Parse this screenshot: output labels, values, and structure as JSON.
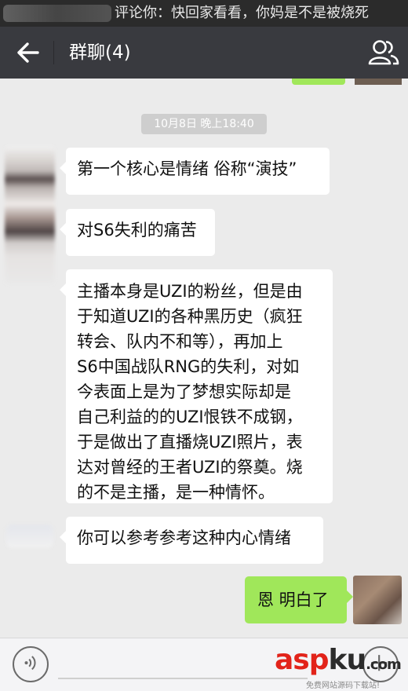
{
  "notification": {
    "text": "评论你：快回家看看，你妈是不是被烧死"
  },
  "header": {
    "title": "群聊(4)"
  },
  "chat": {
    "timestamp": "10月8日 晚上18:40",
    "messages": [
      {
        "side": "left",
        "text": "第一个核心是情绪   俗称“演技”"
      },
      {
        "side": "left",
        "text": "对S6失利的痛苦"
      },
      {
        "side": "left",
        "lines": [
          "主播本身是UZI的粉丝，但是由",
          "于知道UZI的各种黑历史（疯狂",
          "转会、队内不和等），再加上",
          "S6中国战队RNG的失利，对如",
          "今表面上是为了梦想实际却是",
          "自己利益的的UZI恨铁不成钢，",
          "于是做出了直播烧UZI照片，表",
          "达对曾经的王者UZI的祭奠。烧",
          "的不是主播，是一种情怀。"
        ]
      },
      {
        "side": "left",
        "text": "你可以参考参考这种内心情绪"
      },
      {
        "side": "right",
        "text": "恩  明白了"
      }
    ]
  },
  "watermark": {
    "logo_main": "asp",
    "logo_tail": "ku",
    "logo_suffix": ".com",
    "subtitle": "免费网站源码下载站!"
  },
  "icons": {
    "back": "back-arrow-icon",
    "people": "group-members-icon",
    "voice": "voice-icon",
    "plus": "plus-icon"
  },
  "colors": {
    "appbar": "#393a3f",
    "chat_bg": "#ebebeb",
    "my_bubble": "#a0e75a",
    "watermark_red": "#e2231a"
  }
}
